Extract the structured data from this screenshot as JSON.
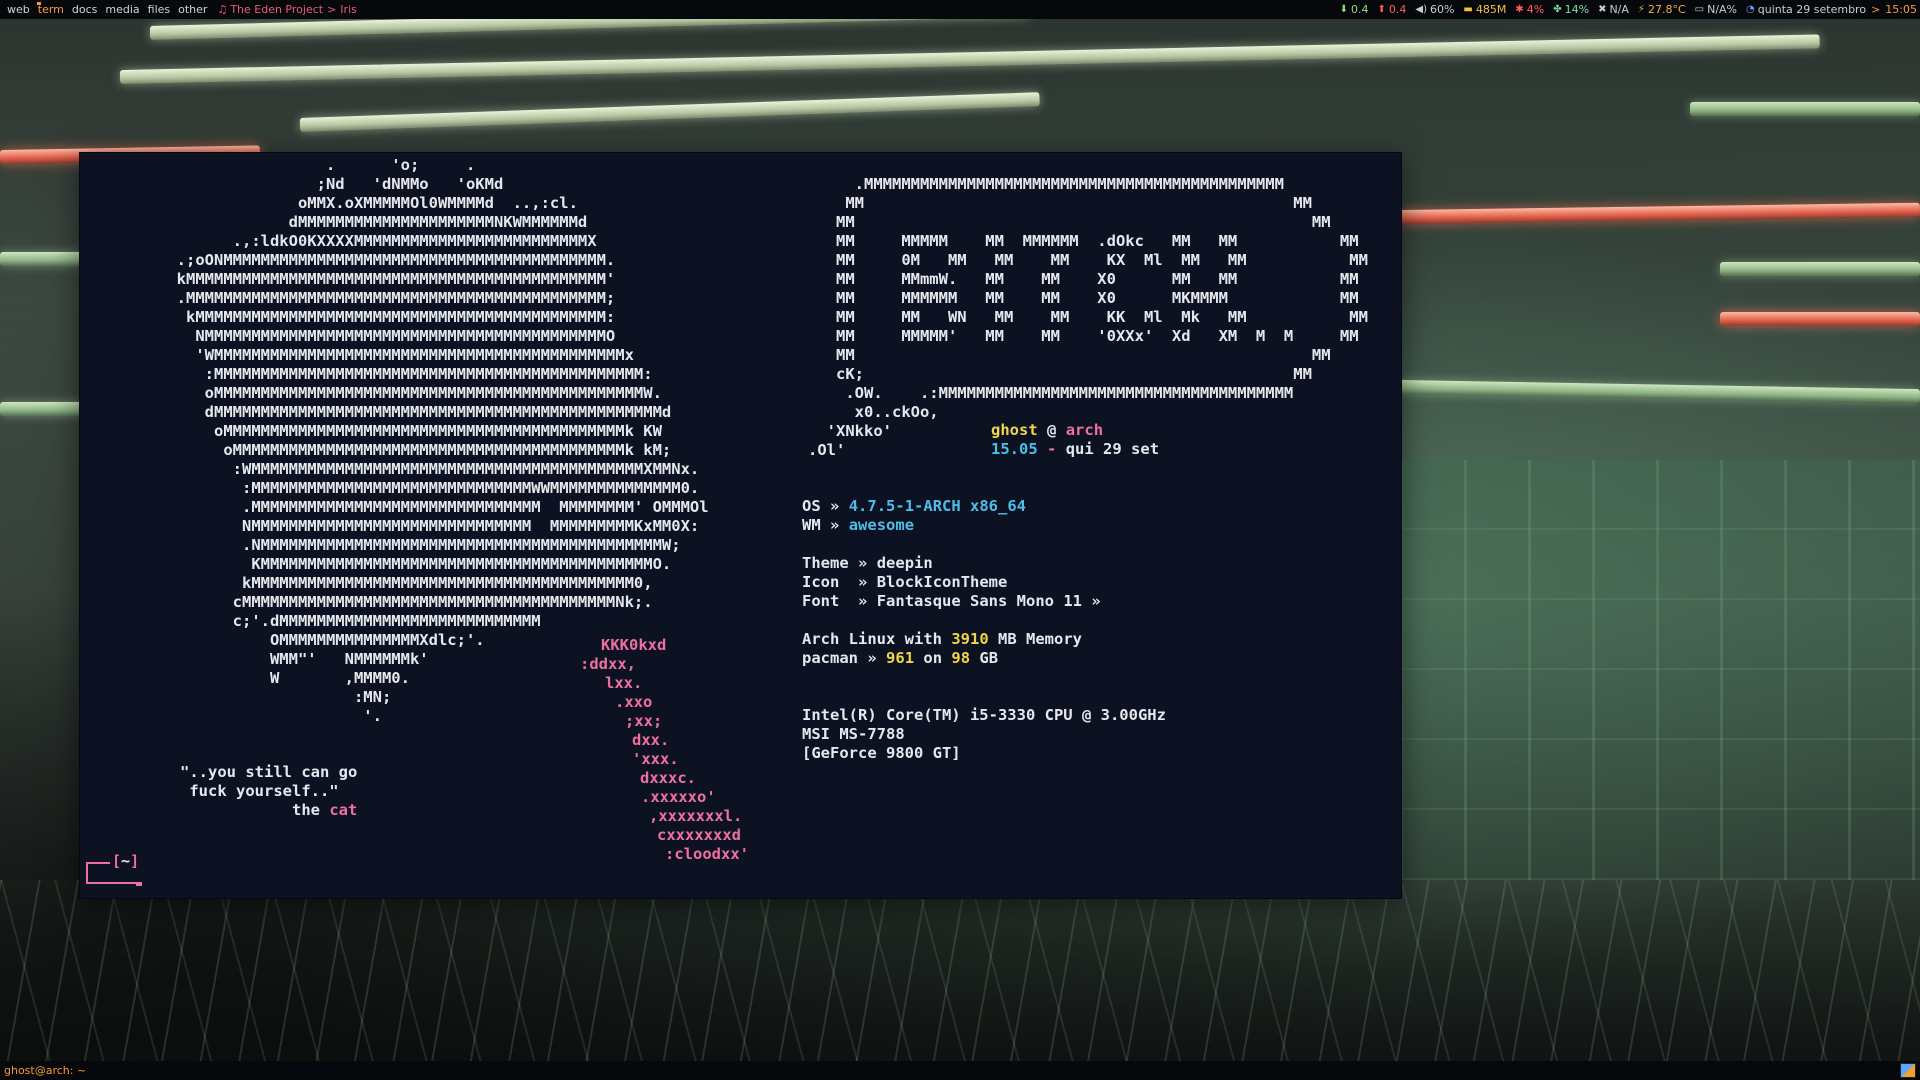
{
  "topbar": {
    "tags": [
      "web",
      "term",
      "docs",
      "media",
      "files",
      "other"
    ],
    "active_tag": "term",
    "now_playing": {
      "icon": "music-note-icon",
      "artist": "The Eden Project",
      "separator": ">",
      "title": "Iris"
    },
    "widgets": {
      "net_down": "0.4",
      "net_up": "0.4",
      "volume": "60%",
      "memory": "485M",
      "cpu": "4%",
      "fan": "14%",
      "network": "N/A",
      "temperature": "27.8°C",
      "battery": "N/A%",
      "date": "quinta 29 setembro",
      "separator": ">",
      "time": "15:05"
    }
  },
  "terminal": {
    "cat_art": [
      "                     .      'o;     .",
      "                    ;Nd   'dNMMo   'oKMd",
      "                  oMMX.oXMMMMMOl0WMMMMd  ..,:cl.",
      "                 dMMMMMMMMMMMMMMMMMMMMMNKWMMMMMMd",
      "           .,:ldkO0KXXXXMMMMMMMMMMMMMMMMMMMMMMMMMX",
      "     .;oONMMMMMMMMMMMMMMMMMMMMMMMMMMMMMMMMMMMMMMMMM.",
      "     kMMMMMMMMMMMMMMMMMMMMMMMMMMMMMMMMMMMMMMMMMMMMM'",
      "     .MMMMMMMMMMMMMMMMMMMMMMMMMMMMMMMMMMMMMMMMMMMMM;",
      "      kMMMMMMMMMMMMMMMMMMMMMMMMMMMMMMMMMMMMMMMMMMMM:",
      "       NMMMMMMMMMMMMMMMMMMMMMMMMMMMMMMMMMMMMMMMMMMMO",
      "       'WMMMMMMMMMMMMMMMMMMMMMMMMMMMMMMMMMMMMMMMMMMMMx",
      "        :MMMMMMMMMMMMMMMMMMMMMMMMMMMMMMMMMMMMMMMMMMMMMM:",
      "        oMMMMMMMMMMMMMMMMMMMMMMMMMMMMMMMMMMMMMMMMMMMMMMW.",
      "        dMMMMMMMMMMMMMMMMMMMMMMMMMMMMMMMMMMMMMMMMMMMMMMMMd",
      "         oMMMMMMMMMMMMMMMMMMMMMMMMMMMMMMMMMMMMMMMMMMMk KW",
      "          oMMMMMMMMMMMMMMMMMMMMMMMMMMMMMMMMMMMMMMMMMMk kM;",
      "           :WMMMMMMMMMMMMMMMMMMMMMMMMMMMMMMMMMMMMMMMMMMXMMNx.",
      "            :MMMMMMMMMMMMMMMMMMMMMMMMMMMMMMWWMMMMMMMMMMMMMM0.",
      "            .MMMMMMMMMMMMMMMMMMMMMMMMMMMMMMM  MMMMMMMM' OMMMOl",
      "            NMMMMMMMMMMMMMMMMMMMMMMMMMMMMMM  MMMMMMMMMKxMM0X:",
      "            .NMMMMMMMMMMMMMMMMMMMMMMMMMMMMMMMMMMMMMMMMMMMW;",
      "             KMMMMMMMMMMMMMMMMMMMMMMMMMMMMMMMMMMMMMMMMMMO.",
      "            kMMMMMMMMMMMMMMMMMMMMMMMMMMMMMMMMMMMMMMMMM0,",
      "           cMMMMMMMMMMMMMMMMMMMMMMMMMMMMMMMMMMMMMMMMNk;.",
      "           c;'.dMMMMMMMMMMMMMMMMMMMMMMMMMMMM ",
      "               OMMMMMMMMMMMMMMMXdlc;'.   ",
      "               WMM\"'   NMMMMMMk'          ",
      "               W       ,MMMM0.            ",
      "                        :MN;              ",
      "                         '.               "
    ],
    "cat_tail": [
      "KKK0kxd",
      ":ddxx,",
      "lxx.",
      ".xxo",
      ";xx;",
      "dxx.",
      "'xxx.",
      "dxxxc.",
      ".xxxxxo'",
      ",xxxxxxxl.",
      "cxxxxxxxd",
      ":cloodxx'"
    ],
    "quote": {
      "line1": "\"..you still can go",
      "line2": " fuck yourself..\"",
      "signoff": "the",
      "signoff_name": "cat"
    },
    "logo_art": [
      "        .MMMMMMMMMMMMMMMMMMMMMMMMMMMMMMMMMMMMMMMMMMMMM",
      "       MM                                              MM",
      "      MM                                                 MM",
      "      MM     MMMMM    MM  MMMMMM  .dOkc   MM   MM           MM",
      "      MM     0M   MM   MM    MM    KX  Ml  MM   MM           MM",
      "      MM     MMmmW.   MM    MM    X0      MM   MM           MM",
      "      MM     MMMMMM   MM    MM    X0      MKMMMM            MM",
      "      MM     MM   WN   MM    MM    KK  Ml  Mk   MM           MM",
      "      MM     MMMMM'   MM    MM    '0XXx'  Xd   XM  M  M     MM",
      "      MM                                                 MM",
      "      cK;                                              MM",
      "       .OW.    .:MMMMMMMMMMMMMMMMMMMMMMMMMMMMMMMMMMMMMM",
      "        x0..ckOo,",
      "     'XNkko'",
      "   .Ol'"
    ],
    "user": {
      "name": "ghost",
      "at": "@",
      "host": "arch",
      "time": "15.05",
      "dash": "-",
      "date": "qui 29 set"
    },
    "info": {
      "os_label": "OS",
      "os_value": "4.7.5-1-ARCH x86_64",
      "wm_label": "WM",
      "wm_value": "awesome",
      "theme_label": "Theme",
      "theme_value": "deepin",
      "icon_label": "Icon ",
      "icon_value": "BlockIconTheme",
      "font_label": "Font ",
      "font_value": "Fantasque Sans Mono 11 »",
      "arrow": "»",
      "memory_prefix": "Arch Linux with",
      "memory_value": "3910",
      "memory_suffix": "MB Memory",
      "pacman_label": "pacman",
      "pacman_count": "961",
      "pacman_on": "on",
      "pacman_size": "98",
      "pacman_unit": "GB",
      "cpu": "Intel(R) Core(TM) i5-3330 CPU @ 3.00GHz",
      "board": "MSI MS-7788",
      "gpu": "[GeForce 9800 GT]"
    },
    "prompt": {
      "open": "[",
      "dir": "~",
      "close": "]"
    }
  },
  "bottombar": {
    "task": "ghost@arch: ~"
  },
  "colors": {
    "accent_orange": "#f59a3c",
    "pink": "#ef6fa0",
    "cyan": "#4fbce6",
    "yellow": "#f0d54a",
    "terminal_bg": "#0d1222"
  }
}
